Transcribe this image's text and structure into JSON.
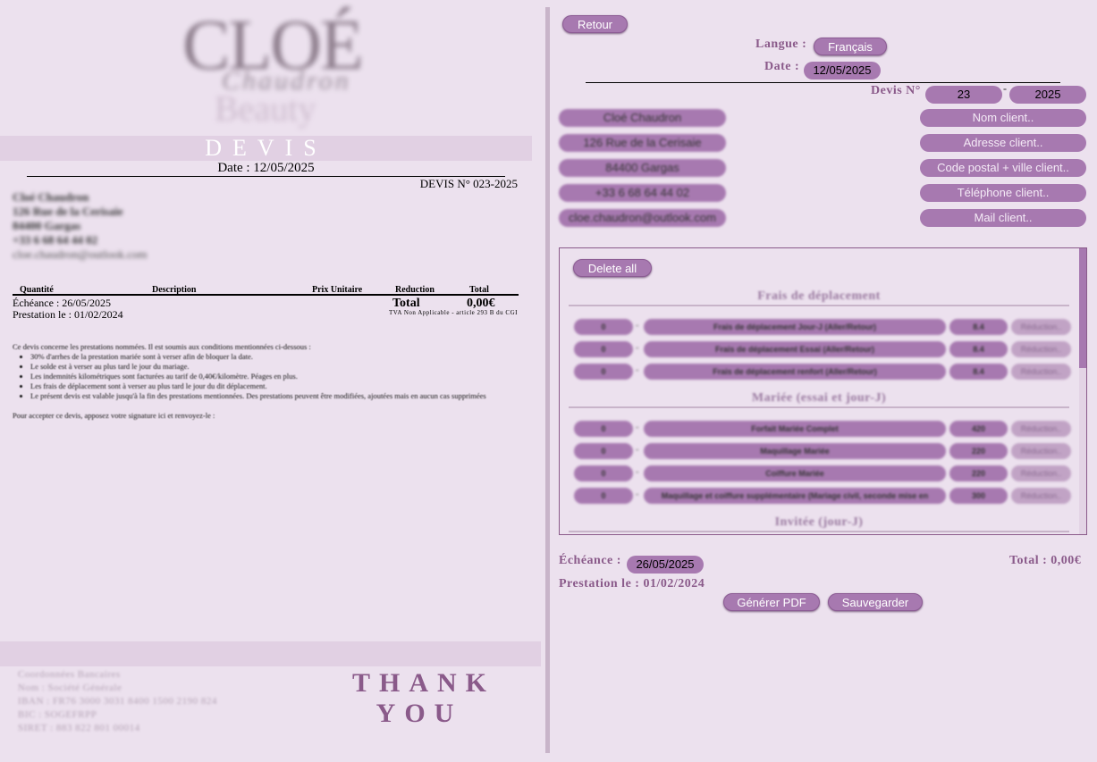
{
  "preview": {
    "logo": {
      "line1": "CLOÉ",
      "line2": "Chaudron",
      "line3": "Beauty"
    },
    "title": "DEVIS",
    "date_line": "Date : 12/05/2025",
    "devis_number": "DEVIS N° 023-2025",
    "sender": {
      "name": "Cloé Chaudron",
      "street": "126 Rue de la Cerisaie",
      "city": "84400 Gargas",
      "phone": "+33 6 68 64 44 02",
      "email": "cloe.chaudron@outlook.com"
    },
    "table_headers": {
      "qty": "Quantité",
      "desc": "Description",
      "unit": "Prix Unitaire",
      "reduction": "Reduction",
      "total": "Total"
    },
    "echeance": "Échéance : 26/05/2025",
    "prestation": "Prestation le : 01/02/2024",
    "total_label": "Total",
    "total_value": "0,00€",
    "tva_note": "TVA Non Applicable - article 293 B du CGI",
    "conditions": {
      "intro": "Ce devis concerne les prestations nommées. Il est soumis aux conditions mentionnées ci-dessous :",
      "items": [
        "30% d'arrhes de la prestation mariée sont à verser afin de bloquer la date.",
        "Le solde est à verser au plus tard le jour du mariage.",
        "Les indemnités kilométriques sont facturées au tarif de 0,40€/kilomètre. Péages en plus.",
        "Les frais de déplacement sont à verser au plus tard le jour du dit déplacement.",
        "Le présent devis est valable jusqu'à la fin des prestations mentionnées. Des prestations peuvent être modifiées, ajoutées mais en aucun cas supprimées"
      ],
      "accept": "Pour accepter ce devis, apposez votre signature ici et renvoyez-le :"
    },
    "bank": {
      "title": "Coordonnées Bancaires",
      "name": "Nom : Société Générale",
      "iban": "IBAN : FR76 3000 3031 8400 1500 2190 824",
      "bic": "BIC : SOGEFRPP",
      "siret": "SIRET : 883 822 801 00014"
    },
    "thanks_line1": "THANK",
    "thanks_line2": "YOU"
  },
  "form": {
    "back_button": "Retour",
    "language_label": "Langue :",
    "language_value": "Français",
    "date_label": "Date :",
    "date_value": "12/05/2025",
    "devis_label": "Devis N°",
    "devis_num": "23",
    "devis_sep": "-",
    "devis_year": "2025",
    "sender_fields": [
      "Cloé Chaudron",
      "126 Rue de la Cerisaie",
      "84400 Gargas",
      "+33 6 68 64 44 02",
      "cloe.chaudron@outlook.com"
    ],
    "client_placeholders": [
      "Nom client..",
      "Adresse client..",
      "Code postal + ville client..",
      "Téléphone client..",
      "Mail client.."
    ],
    "delete_all": "Delete all",
    "sections": [
      {
        "title": "Frais de déplacement",
        "rows": [
          {
            "qty": "0",
            "desc": "Frais de déplacement Jour-J (Aller/Retour)",
            "price": "8.4",
            "reduction": "Réduction.."
          },
          {
            "qty": "0",
            "desc": "Frais de déplacement Essai (Aller/Retour)",
            "price": "8.4",
            "reduction": "Réduction.."
          },
          {
            "qty": "0",
            "desc": "Frais de déplacement renfort (Aller/Retour)",
            "price": "8.4",
            "reduction": "Réduction.."
          }
        ]
      },
      {
        "title": "Mariée (essai et jour-J)",
        "rows": [
          {
            "qty": "0",
            "desc": "Forfait Mariée Complet",
            "price": "420",
            "reduction": "Réduction.."
          },
          {
            "qty": "0",
            "desc": "Maquillage Mariée",
            "price": "220",
            "reduction": "Réduction.."
          },
          {
            "qty": "0",
            "desc": "Coiffure Mariée",
            "price": "220",
            "reduction": "Réduction.."
          },
          {
            "qty": "0",
            "desc": "Maquillage et coiffure supplémentaire (Mariage civil, seconde mise en",
            "price": "300",
            "reduction": "Réduction.."
          }
        ]
      },
      {
        "title": "Invitée (jour-J)",
        "rows": []
      }
    ],
    "echeance_label": "Échéance :",
    "echeance_value": "26/05/2025",
    "prestation_text": "Prestation le : 01/02/2024",
    "total_text": "Total : 0,00€",
    "generate_pdf": "Générer PDF",
    "save": "Sauvegarder"
  },
  "colors": {
    "background": "#ece1ee",
    "accent": "#a779b0",
    "label": "#8a5a8a"
  }
}
